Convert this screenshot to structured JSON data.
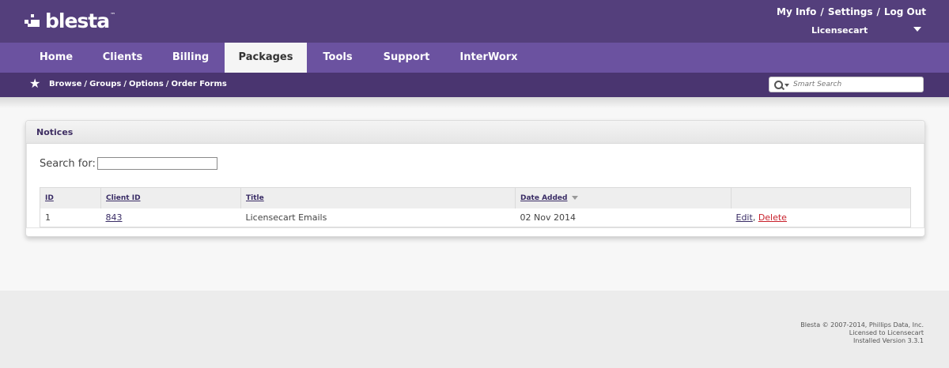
{
  "brand": {
    "name": "blesta",
    "tm": "™"
  },
  "top_links": {
    "my_info": "My Info",
    "settings": "Settings",
    "log_out": "Log Out",
    "separator": "/"
  },
  "account": {
    "name": "Licensecart"
  },
  "nav": {
    "tabs": [
      {
        "label": "Home"
      },
      {
        "label": "Clients"
      },
      {
        "label": "Billing"
      },
      {
        "label": "Packages",
        "active": true
      },
      {
        "label": "Tools"
      },
      {
        "label": "Support"
      },
      {
        "label": "InterWorx"
      }
    ]
  },
  "subnav": {
    "crumbs": [
      "Browse",
      "Groups",
      "Options",
      "Order Forms"
    ],
    "separator": "/"
  },
  "search": {
    "placeholder": "Smart Search"
  },
  "panel": {
    "title": "Notices",
    "search_label": "Search for:",
    "search_value": "",
    "columns": [
      "ID",
      "Client ID",
      "Title",
      "Date Added",
      ""
    ],
    "sorted_column": "Date Added",
    "rows": [
      {
        "id": "1",
        "client_id": "843",
        "title": "Licensecart Emails",
        "date_added": "02 Nov 2014",
        "edit": "Edit",
        "delete": "Delete",
        "comma": ","
      }
    ]
  },
  "footer": {
    "line1": "Blesta © 2007-2014, Phillips Data, Inc.",
    "line2": "Licensed to Licensecart",
    "line3": "Installed Version 3.3.1"
  },
  "colors": {
    "header": "#543f7c",
    "nav": "#6b52a0",
    "subnav": "#4a3570",
    "delete": "#c8202b",
    "link": "#3a2d66"
  }
}
